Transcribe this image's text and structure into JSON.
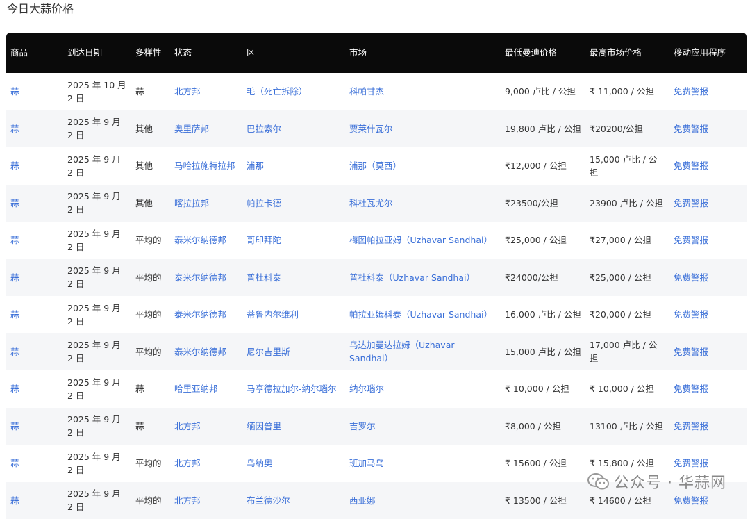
{
  "page": {
    "title": "今日大蒜价格"
  },
  "table": {
    "headers": [
      "商品",
      "到达日期",
      "多样性",
      "状态",
      "区",
      "市场",
      "最低曼迪价格",
      "最高市场价格",
      "移动应用程序"
    ],
    "rows": [
      {
        "commodity": "蒜",
        "date": "2025 年 10 月 2 日",
        "variety": "蒜",
        "state": "北方邦",
        "district": "毛（死亡拆除）",
        "market": "科帕甘杰",
        "min": "9,000 卢比 / 公担",
        "max": "₹ 11,000 / 公担",
        "app": "免费警报"
      },
      {
        "commodity": "蒜",
        "date": "2025 年 9 月 2 日",
        "variety": "其他",
        "state": "奥里萨邦",
        "district": "巴拉索尔",
        "market": "贾莱什瓦尔",
        "min": "19,800 卢比 / 公担",
        "max": "₹20200/公担",
        "app": "免费警报"
      },
      {
        "commodity": "蒜",
        "date": "2025 年 9 月 2 日",
        "variety": "其他",
        "state": "马哈拉施特拉邦",
        "district": "浦那",
        "market": "浦那（莫西）",
        "min": "₹12,000 / 公担",
        "max": "15,000 卢比 / 公担",
        "app": "免费警报"
      },
      {
        "commodity": "蒜",
        "date": "2025 年 9 月 2 日",
        "variety": "其他",
        "state": "喀拉拉邦",
        "district": "帕拉卡德",
        "market": "科杜瓦尤尔",
        "min": "₹23500/公担",
        "max": "23900 卢比 / 公担",
        "app": "免费警报"
      },
      {
        "commodity": "蒜",
        "date": "2025 年 9 月 2 日",
        "variety": "平均的",
        "state": "泰米尔纳德邦",
        "district": "哥印拜陀",
        "market": "梅图帕拉亚姆（Uzhavar Sandhai）",
        "min": "₹25,000 / 公担",
        "max": "₹27,000 / 公担",
        "app": "免费警报"
      },
      {
        "commodity": "蒜",
        "date": "2025 年 9 月 2 日",
        "variety": "平均的",
        "state": "泰米尔纳德邦",
        "district": "普杜科泰",
        "market": "普杜科泰（Uzhavar Sandhai）",
        "min": "₹24000/公担",
        "max": "₹25,000 / 公担",
        "app": "免费警报"
      },
      {
        "commodity": "蒜",
        "date": "2025 年 9 月 2 日",
        "variety": "平均的",
        "state": "泰米尔纳德邦",
        "district": "蒂鲁内尔维利",
        "market": "帕拉亚姆科泰（Uzhavar Sandhai）",
        "min": "16,000 卢比 / 公担",
        "max": "₹20,000 / 公担",
        "app": "免费警报"
      },
      {
        "commodity": "蒜",
        "date": "2025 年 9 月 2 日",
        "variety": "平均的",
        "state": "泰米尔纳德邦",
        "district": "尼尔吉里斯",
        "market": "乌达加曼达拉姆（Uzhavar Sandhai）",
        "min": "15,000 卢比 / 公担",
        "max": "17,000 卢比 / 公担",
        "app": "免费警报"
      },
      {
        "commodity": "蒜",
        "date": "2025 年 9 月 2 日",
        "variety": "蒜",
        "state": "哈里亚纳邦",
        "district": "马亨德拉加尔-纳尔瑙尔",
        "market": "纳尔瑙尔",
        "min": "₹ 10,000 / 公担",
        "max": "₹ 10,000 / 公担",
        "app": "免费警报"
      },
      {
        "commodity": "蒜",
        "date": "2025 年 9 月 2 日",
        "variety": "蒜",
        "state": "北方邦",
        "district": "缅因普里",
        "market": "吉罗尔",
        "min": "₹8,000 / 公担",
        "max": "13100 卢比 / 公担",
        "app": "免费警报"
      },
      {
        "commodity": "蒜",
        "date": "2025 年 9 月 2 日",
        "variety": "平均的",
        "state": "北方邦",
        "district": "乌纳奥",
        "market": "班加马乌",
        "min": "₹ 15600 / 公担",
        "max": "₹ 15,800 / 公担",
        "app": "免费警报"
      },
      {
        "commodity": "蒜",
        "date": "2025 年 9 月 2 日",
        "variety": "平均的",
        "state": "北方邦",
        "district": "布兰德沙尔",
        "market": "西亚娜",
        "min": "₹ 13500 / 公担",
        "max": "₹ 14600 / 公担",
        "app": "免费警报"
      }
    ]
  },
  "watermark": {
    "text": "公众号 · 华蒜网",
    "icon": "wechat-icon"
  }
}
